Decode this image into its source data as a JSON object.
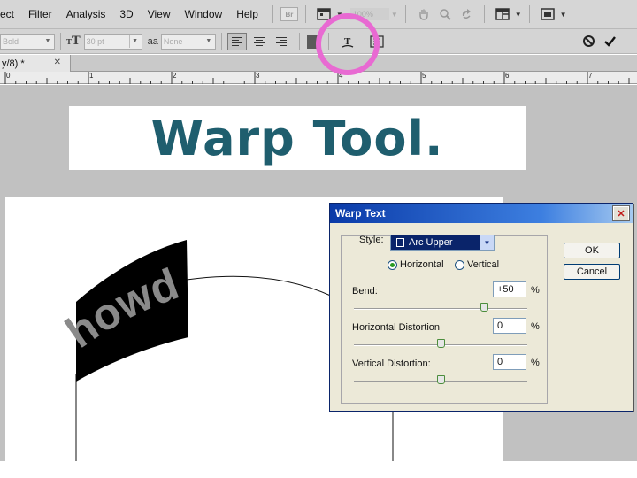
{
  "menubar": {
    "items": [
      "ect",
      "Filter",
      "Analysis",
      "3D",
      "View",
      "Window",
      "Help"
    ],
    "br_label": "Br"
  },
  "options": {
    "font_style": "Bold",
    "font_size": "30 pt",
    "antialias_label": "aa",
    "antialias_value": "None"
  },
  "document": {
    "tab_label": "y/8) *",
    "ruler_numbers": [
      "0",
      "1",
      "2",
      "3",
      "4",
      "5",
      "6",
      "7"
    ]
  },
  "banner": {
    "title": "Warp Tool."
  },
  "canvas": {
    "warped_text": "howdy"
  },
  "dialog": {
    "title": "Warp Text",
    "style_label": "Style:",
    "style_value": "Arc Upper",
    "horizontal_label": "Horizontal",
    "vertical_label": "Vertical",
    "orientation_selected": "Horizontal",
    "bend_label": "Bend:",
    "bend_value": "+50",
    "hdist_label": "Horizontal Distortion",
    "hdist_value": "0",
    "vdist_label": "Vertical Distortion:",
    "vdist_value": "0",
    "percent": "%",
    "ok_label": "OK",
    "cancel_label": "Cancel",
    "bend_level": 0.75,
    "hdist_level": 0.5,
    "vdist_level": 0.5
  },
  "colors": {
    "title_text": "#1f5e6e",
    "annotation_circle": "#e86ad2",
    "dialog_titlebar": "#0a3aa8"
  },
  "icons": [
    "hand-icon",
    "zoom-icon",
    "rotate-view-icon",
    "arrange-documents-icon",
    "screen-mode-icon",
    "text-orientation-icon",
    "warp-text-icon",
    "character-paragraph-panel-icon",
    "cancel-icon",
    "commit-icon"
  ]
}
